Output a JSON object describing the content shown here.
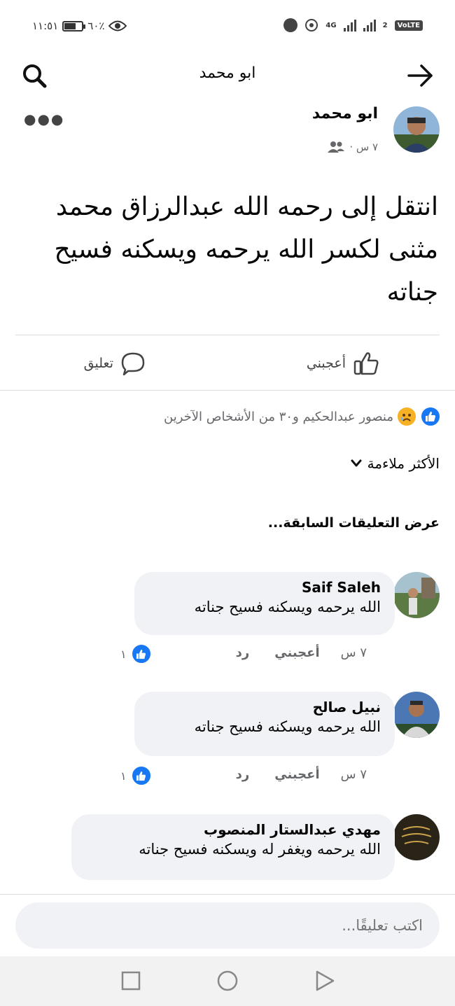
{
  "status_bar": {
    "time": "١١:٥١",
    "battery": "٦٠٪",
    "battery_level": 0.6,
    "network": "4G",
    "sim": "2",
    "volte": "VoLTE"
  },
  "header": {
    "title": "ابو محمد"
  },
  "post": {
    "author": "ابو محمد",
    "time": "٧ س ·",
    "text": "انتقل إلى رحمه الله عبدالرزاق محمد مثنى لكسر الله يرحمه ويسكنه فسيح جناته",
    "like_label": "أعجبني",
    "comment_label": "تعليق"
  },
  "reactions": {
    "summary": "منصور عبدالحكيم و٣٠ من الأشخاص الآخرين"
  },
  "sort": {
    "label": "الأكثر ملاءمة"
  },
  "previous_comments_label": "عرض التعليقات السابقة...",
  "comments": [
    {
      "name": "Saif Saleh",
      "text": "الله يرحمه ويسكنه فسيح جناته",
      "time": "٧ س",
      "like_label": "أعجبني",
      "reply_label": "رد",
      "like_count": "١"
    },
    {
      "name": "نبيل صالح",
      "text": "الله يرحمه ويسكنه فسيح جناته",
      "time": "٧ س",
      "like_label": "أعجبني",
      "reply_label": "رد",
      "like_count": "١"
    },
    {
      "name": "مهدي عبدالستار المنصوب",
      "text": "الله يرحمه ويغفر له ويسكنه فسيح جناته"
    }
  ],
  "composer": {
    "placeholder": "اكتب تعليقًا..."
  },
  "colors": {
    "accent": "#1877f2",
    "bubble": "#f0f2f5",
    "secondary_text": "#65676b"
  }
}
